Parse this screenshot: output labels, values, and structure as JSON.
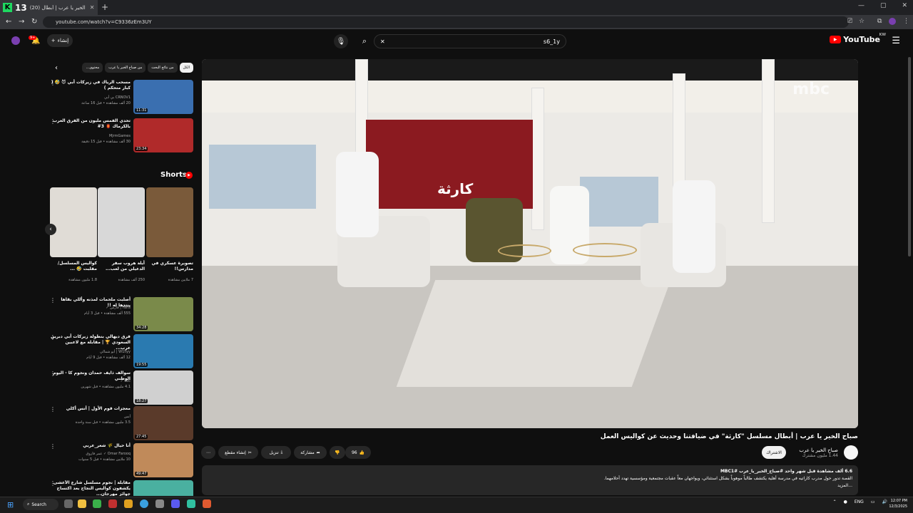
{
  "browser": {
    "tab_number": "13",
    "tab_title": "(20) صباح الخير يا عرب | أبطال ...",
    "url": "youtube.com/watch?v=C9336zEm3UY"
  },
  "youtube": {
    "logo": "YouTube",
    "logo_sup": "KW",
    "search_value": "s6_1y",
    "create_label": "إنشاء",
    "notif_count": "9+"
  },
  "video": {
    "title": "صباح الخير يا عرب | أبطال مسلسل \"كارثة\" في ضيافتنا وحديث عن كواليس العمل",
    "channel": "صباح الخير يا عرب",
    "subscribers": "1.44 مليون مشترك",
    "subscribe_label": "الاشتراك",
    "likes": "96",
    "share_label": "مشاركة",
    "download_label": "تنزيل",
    "clip_label": "إنشاء مقطع",
    "description_stats": "6.6 ألف مشاهدة  قبل شهر واحد  #صباح_الخير_يا_عرب  #MBC1",
    "description_text": "القصة تدور حول مدرب كاراتيه في مدرسة أهلية يكتشف طالباً موهوباً بشكل استثنائي، ويواجهان معاً عقبات مجتمعية ومؤسسية تهدد أحلامهما.",
    "more_label": "...المزيد",
    "screen_text": "كارثة",
    "watermark": "mbc"
  },
  "chips": [
    "الكل",
    "من نتائج البحث",
    "من صباح الخير يا عرب",
    "محتوى..."
  ],
  "related_top": [
    {
      "title": "مسحب الرياك في زيركات أبي 😈 🤣 ( كبار متحكم )",
      "channel": "CRNOV1 بي أبي",
      "meta": "20 ألف مشاهدة • قبل 16 ساعة",
      "duration": "11:31",
      "color": "#3a6fb0"
    },
    {
      "title": "تحدي الفمس مليون من الفرق العرب بالكرماك 🏮 3#",
      "channel": "MjrmGames",
      "meta": "30 ألف مشاهدة • قبل 15 دقيقة",
      "duration": "23:34",
      "color": "#b02a2a"
    }
  ],
  "shorts_title": "Shorts",
  "shorts": [
    {
      "title": "تصويرة عسكري في مدارس!!",
      "views": "7 ملايين مشاهدة",
      "color": "#7a5a3a"
    },
    {
      "title": "أيلة هروب سفر الدعيلي من لعب...",
      "views": "250 ألف مشاهدة",
      "color": "#d8d8d8"
    },
    {
      "title": "كواليس المسلسل/ مقلبت 🤣 ...",
      "views": "1.8 مليون مشاهدة",
      "color": "#e0dcd6"
    }
  ],
  "related_bottom": [
    {
      "title": "أصلبت ملحمات لمذنه وأللي بقاها ينتدها له !!",
      "channel": "Faris | فارس ✓",
      "meta": "555 ألف مشاهدة • قبل 3 أيام",
      "duration": "34:28",
      "color": "#7a8a4a"
    },
    {
      "title": "فرق ديهالي بنطولة زيركات أبي دبرين السعودي 🏆 | مقابلة مع لاعبين عرب...",
      "channel": "W1llyy | أبو شمالي",
      "meta": "12 ألف مشاهدة • قبل 9 أيام",
      "duration": "19:55",
      "color": "#2a7ab0"
    },
    {
      "title": "سوالف ذايف حمدان ونجوم كا - اليوم الوطني",
      "channel": "sbc ✓",
      "meta": "4.1 مليون مشاهدة • قبل شهرين",
      "duration": "18:27",
      "color": "#d0d0d0"
    },
    {
      "title": "معجزات قوم الأول | أنس أكلي",
      "channel": "أنس",
      "meta": "3.5 مليون مشاهدة • قبل سنة واحدة",
      "duration": "27:45",
      "color": "#5a3a2a"
    },
    {
      "title": "أنا حيال 🌾 شعر_عربي",
      "channel": "Omar Farooq ✓ عمر فاروق",
      "meta": "10 ملايين مشاهدة • قبل 5 سنوات",
      "duration": "49:47",
      "color": "#c08a5a"
    },
    {
      "title": "مقابلة | نجوم مسلسل شارع الأعشى يكشفون كواليس النجاح بعد اكتساح جوائز مهرجان...",
      "channel": "",
      "meta": "",
      "duration": "",
      "color": "#4ab0a0"
    }
  ],
  "taskbar": {
    "search_label": "Search",
    "lang": "ENG",
    "time": "12:07 PM",
    "date": "12/3/2025"
  }
}
